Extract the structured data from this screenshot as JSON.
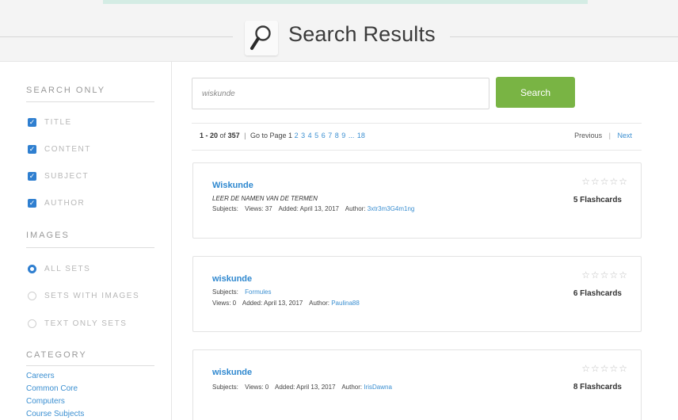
{
  "header": {
    "title": "Search Results"
  },
  "sidebar": {
    "search_only_heading": "SEARCH ONLY",
    "filters": [
      {
        "label": "TITLE",
        "checked": true
      },
      {
        "label": "CONTENT",
        "checked": true
      },
      {
        "label": "SUBJECT",
        "checked": true
      },
      {
        "label": "AUTHOR",
        "checked": true
      }
    ],
    "images_heading": "IMAGES",
    "image_options": [
      {
        "label": "ALL SETS",
        "selected": true
      },
      {
        "label": "SETS WITH IMAGES",
        "selected": false
      },
      {
        "label": "TEXT ONLY SETS",
        "selected": false
      }
    ],
    "category_heading": "CATEGORY",
    "categories": [
      "Careers",
      "Common Core",
      "Computers",
      "Course Subjects"
    ]
  },
  "search": {
    "value": "wiskunde",
    "button_label": "Search"
  },
  "pagination": {
    "range": "1 - 20",
    "of_label": "of",
    "total": "357",
    "goto_label": "Go to Page",
    "pages": [
      "1",
      "2",
      "3",
      "4",
      "5",
      "6",
      "7",
      "8",
      "9"
    ],
    "ellipsis": "...",
    "last_page": "18",
    "previous": "Previous",
    "next": "Next"
  },
  "results": [
    {
      "title": "Wiskunde",
      "description": "LEER DE NAMEN VAN DE TERMEN",
      "subjects_label": "Subjects:",
      "subjects": "",
      "views": "Views: 37",
      "added": "Added: April 13, 2017",
      "author_label": "Author:",
      "author": "3xtr3m3G4m1ng",
      "stars": "☆☆☆☆☆",
      "flashcards": "5 Flashcards"
    },
    {
      "title": "wiskunde",
      "subjects_label": "Subjects:",
      "subjects": "Formules",
      "views": "Views: 0",
      "added": "Added: April 13, 2017",
      "author_label": "Author:",
      "author": "Paulina88",
      "stars": "☆☆☆☆☆",
      "flashcards": "6 Flashcards"
    },
    {
      "title": "wiskunde",
      "subjects_label": "Subjects:",
      "subjects": "",
      "views": "Views: 0",
      "added": "Added: April 13, 2017",
      "author_label": "Author:",
      "author": "IrisDawna",
      "stars": "☆☆☆☆☆",
      "flashcards": "8 Flashcards"
    }
  ],
  "colors": {
    "accent": "#2f88cf",
    "search_button": "#79b444",
    "checkbox": "#2f7fd0"
  },
  "icons": {
    "title_icon": "magnifier-icon",
    "check_icon": "checkmark-icon",
    "rating_icon": "star-icon"
  }
}
